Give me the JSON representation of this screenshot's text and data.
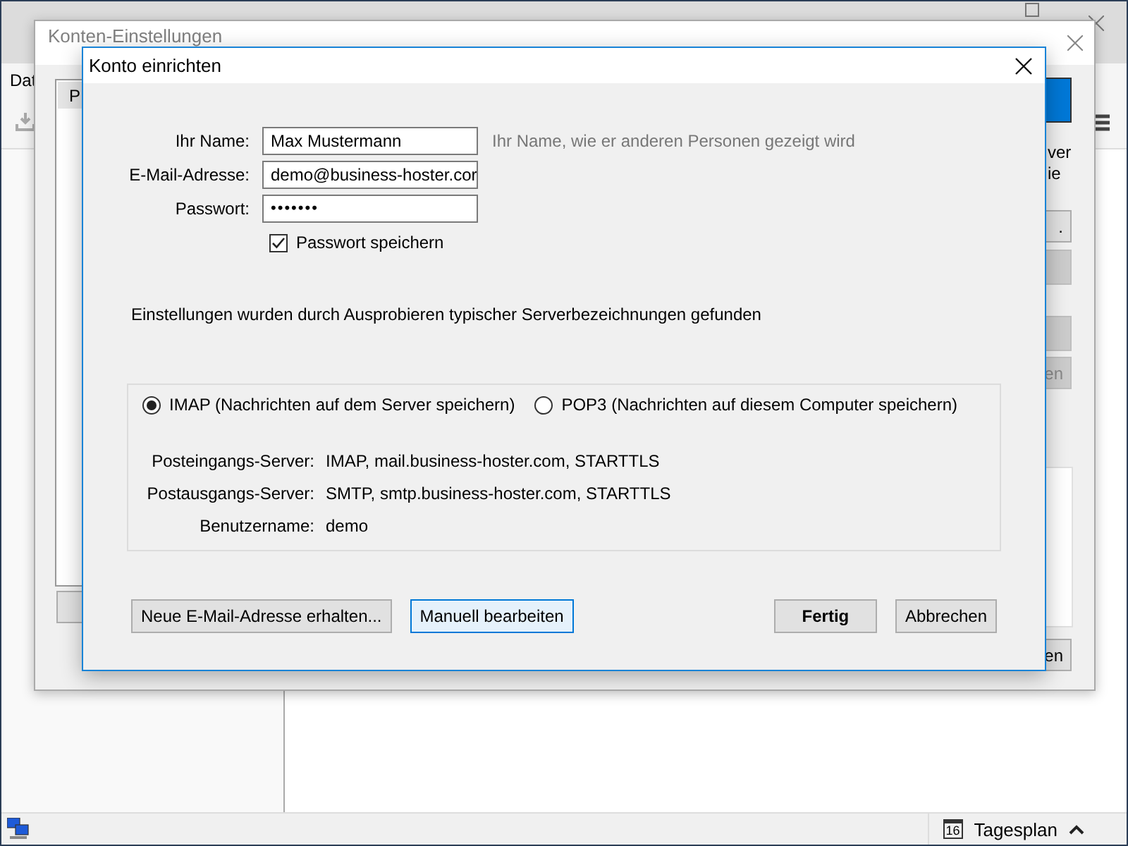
{
  "app": {
    "menu_fragment": "Dat",
    "status_bar": {
      "calendar_day": "16",
      "label": "Tagesplan"
    }
  },
  "account_settings": {
    "title": "Konten-Einstellungen",
    "list_header": "P",
    "side_texts": [
      "ver",
      "ie"
    ],
    "buttons": [
      {
        "label": ".",
        "disabled": false
      },
      {
        "label": "en",
        "disabled": true
      },
      {
        "label": "en",
        "disabled": false
      }
    ]
  },
  "dialog": {
    "title": "Konto einrichten",
    "fields": [
      {
        "label": "Ihr Name:",
        "value": "Max Mustermann",
        "kind": "text",
        "hint": "Ihr Name, wie er anderen Personen gezeigt wird"
      },
      {
        "label": "E-Mail-Adresse:",
        "value": "demo@business-hoster.cor",
        "kind": "text"
      },
      {
        "label": "Passwort:",
        "value": "•••••••",
        "kind": "password"
      }
    ],
    "remember": {
      "label": "Passwort speichern",
      "checked": true
    },
    "message": "Einstellungen wurden durch Ausprobieren typischer Serverbezeichnungen gefunden",
    "protocols": [
      {
        "label": "IMAP (Nachrichten auf dem Server speichern)",
        "selected": true
      },
      {
        "label": "POP3 (Nachrichten auf diesem Computer speichern)",
        "selected": false
      }
    ],
    "server_info": [
      {
        "label": "Posteingangs-Server:",
        "value": "IMAP, mail.business-hoster.com, STARTTLS"
      },
      {
        "label": "Postausgangs-Server:",
        "value": "SMTP, smtp.business-hoster.com, STARTTLS"
      },
      {
        "label": "Benutzername:",
        "value": "demo"
      }
    ],
    "buttons": [
      {
        "label": "Neue E-Mail-Adresse erhalten...",
        "kind": "normal"
      },
      {
        "label": "Manuell bearbeiten",
        "kind": "focused"
      },
      {
        "label": "Fertig",
        "kind": "default"
      },
      {
        "label": "Abbrechen",
        "kind": "normal"
      }
    ]
  }
}
